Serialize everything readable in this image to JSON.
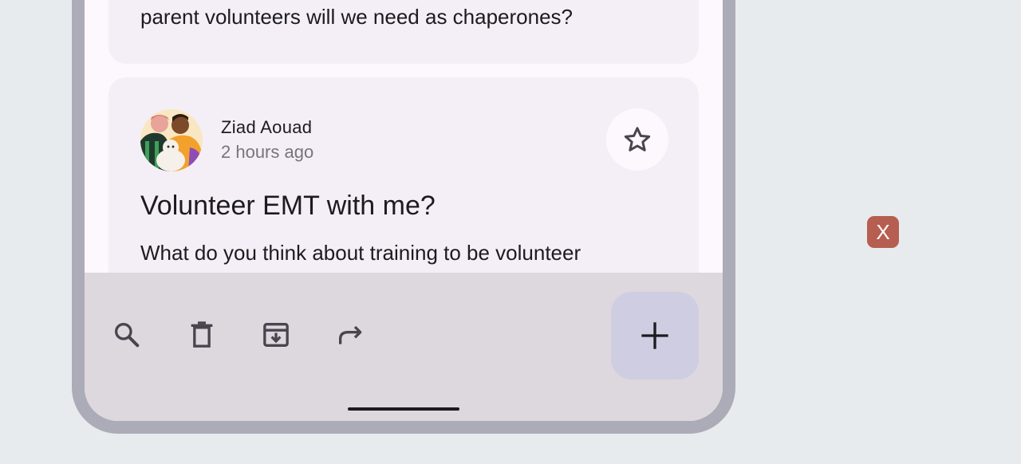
{
  "previous_card": {
    "text": "parent volunteers will we need as chaperones?"
  },
  "card": {
    "author": "Ziad Aouad",
    "time": "2 hours ago",
    "title": "Volunteer EMT with me?",
    "body": "What do you think about training to be volunteer"
  },
  "bottom_bar": {
    "icons": [
      "search-icon",
      "trash-icon",
      "archive-icon",
      "forward-icon"
    ],
    "fab_icon": "plus-icon"
  },
  "overlay": {
    "close_label": "X"
  },
  "colors": {
    "background": "#e8ebee",
    "device_frame": "#acabb8",
    "screen": "#fdf7fe",
    "card": "#f4eff6",
    "bottom_bar": "#ddd8de",
    "fab": "#cfcde2",
    "close_button": "#b65e4f"
  }
}
